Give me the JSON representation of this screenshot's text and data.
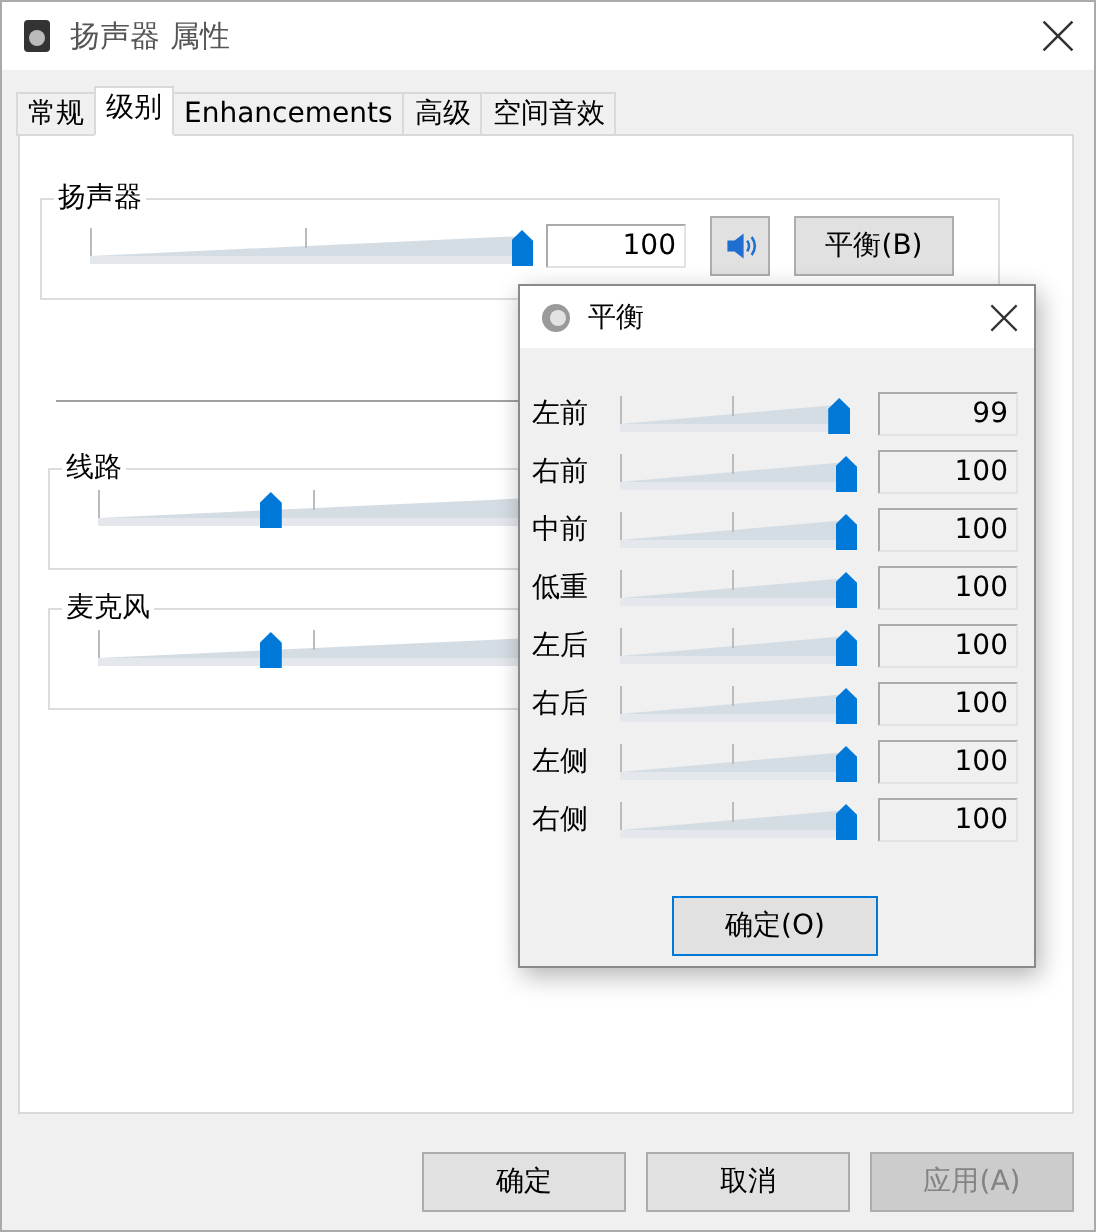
{
  "window": {
    "title": "扬声器 属性"
  },
  "tabs": [
    {
      "label": "常规",
      "selected": false
    },
    {
      "label": "级别",
      "selected": true
    },
    {
      "label": "Enhancements",
      "selected": false
    },
    {
      "label": "高级",
      "selected": false
    },
    {
      "label": "空间音效",
      "selected": false
    }
  ],
  "speaker": {
    "label": "扬声器",
    "level": 1,
    "value": "100",
    "muted": false,
    "balance_button": "平衡(B)"
  },
  "inputs": [
    {
      "label": "线路",
      "level": 0.4
    },
    {
      "label": "麦克风",
      "level": 0.4
    }
  ],
  "balance_dialog": {
    "title": "平衡",
    "channels": [
      {
        "label": "左前",
        "level": 0.97,
        "value": "99"
      },
      {
        "label": "右前",
        "level": 1,
        "value": "100"
      },
      {
        "label": "中前",
        "level": 1,
        "value": "100"
      },
      {
        "label": "低重",
        "level": 1,
        "value": "100"
      },
      {
        "label": "左后",
        "level": 1,
        "value": "100"
      },
      {
        "label": "右后",
        "level": 1,
        "value": "100"
      },
      {
        "label": "左侧",
        "level": 1,
        "value": "100"
      },
      {
        "label": "右侧",
        "level": 1,
        "value": "100"
      }
    ],
    "ok_button": "确定(O)"
  },
  "buttons": [
    {
      "label": "确定",
      "disabled": false
    },
    {
      "label": "取消",
      "disabled": false
    },
    {
      "label": "应用(A)",
      "disabled": true
    }
  ]
}
